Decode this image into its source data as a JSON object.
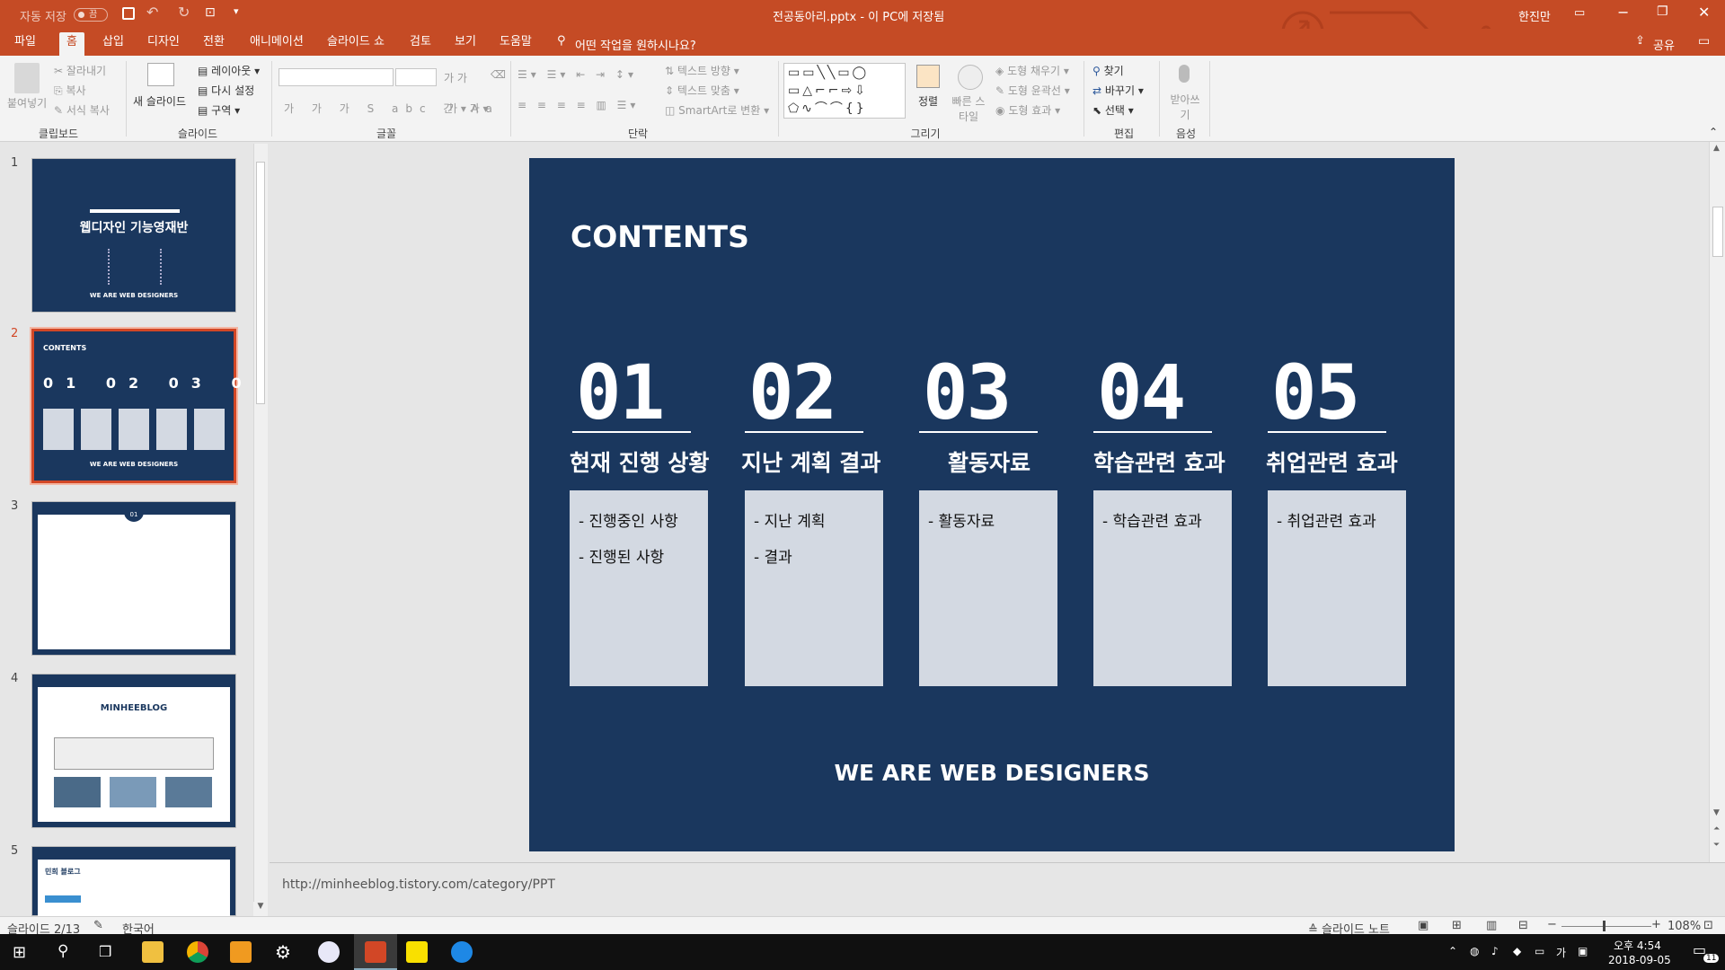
{
  "titlebar": {
    "autosave_label": "자동 저장",
    "autosave_state": "끔",
    "document_title": "전공동아리.pptx - 이 PC에 저장됨",
    "user": "한진만"
  },
  "tabs": [
    {
      "label": "파일"
    },
    {
      "label": "홈"
    },
    {
      "label": "삽입"
    },
    {
      "label": "디자인"
    },
    {
      "label": "전환"
    },
    {
      "label": "애니메이션"
    },
    {
      "label": "슬라이드 쇼"
    },
    {
      "label": "검토"
    },
    {
      "label": "보기"
    },
    {
      "label": "도움말"
    }
  ],
  "tell_me": "어떤 작업을 원하시나요?",
  "share_label": "공유",
  "ribbon": {
    "clipboard": {
      "paste": "붙여넣기",
      "cut": "잘라내기",
      "copy": "복사",
      "format_painter": "서식 복사",
      "label": "클립보드"
    },
    "slides": {
      "new_slide": "새 슬라이드",
      "layout": "레이아웃",
      "reset": "다시 설정",
      "section": "구역",
      "label": "슬라이드"
    },
    "font": {
      "label": "글꼴"
    },
    "paragraph": {
      "text_direction": "텍스트 방향",
      "align_text": "텍스트 맞춤",
      "smartart": "SmartArt로 변환",
      "label": "단락"
    },
    "drawing": {
      "arrange": "정렬",
      "quick_styles": "빠른 스타일",
      "shape_fill": "도형 채우기",
      "shape_outline": "도형 윤곽선",
      "shape_effects": "도형 효과",
      "label": "그리기"
    },
    "editing": {
      "find": "찾기",
      "replace": "바꾸기",
      "select": "선택",
      "label": "편집"
    },
    "voice": {
      "dictate": "받아쓰기",
      "label": "음성"
    }
  },
  "thumbnails": [
    {
      "num": "1",
      "title": "웹디자인 기능영재반",
      "footer": "WE ARE WEB DESIGNERS"
    },
    {
      "num": "2",
      "title": "CONTENTS",
      "footer": "WE ARE WEB DESIGNERS"
    },
    {
      "num": "3",
      "title": "01"
    },
    {
      "num": "4",
      "title": "MINHEEBLOG"
    },
    {
      "num": "5",
      "title": "민희 블로그"
    }
  ],
  "slide": {
    "heading": "CONTENTS",
    "footer": "WE ARE WEB DESIGNERS",
    "columns": [
      {
        "num": "01",
        "title": "현재 진행 상황",
        "items": [
          "- 진행중인 사항",
          "- 진행된 사항"
        ]
      },
      {
        "num": "02",
        "title": "지난 계획 결과",
        "items": [
          "- 지난 계획",
          "- 결과"
        ]
      },
      {
        "num": "03",
        "title": "활동자료",
        "items": [
          "- 활동자료"
        ]
      },
      {
        "num": "04",
        "title": "학습관련 효과",
        "items": [
          "- 학습관련 효과"
        ]
      },
      {
        "num": "05",
        "title": "취업관련 효과",
        "items": [
          "- 취업관련 효과"
        ]
      }
    ]
  },
  "notes": "http://minheeblog.tistory.com/category/PPT",
  "statusbar": {
    "slide_indicator": "슬라이드 2/13",
    "language": "한국어",
    "notes_button": "슬라이드 노트",
    "zoom": "108%"
  },
  "taskbar": {
    "time": "오후 4:54",
    "date": "2018-09-05",
    "ime": "가",
    "notification_count": "11"
  },
  "colors": {
    "accent": "#c54b25",
    "slide_bg": "#1a375e",
    "box": "#d3d9e2"
  }
}
